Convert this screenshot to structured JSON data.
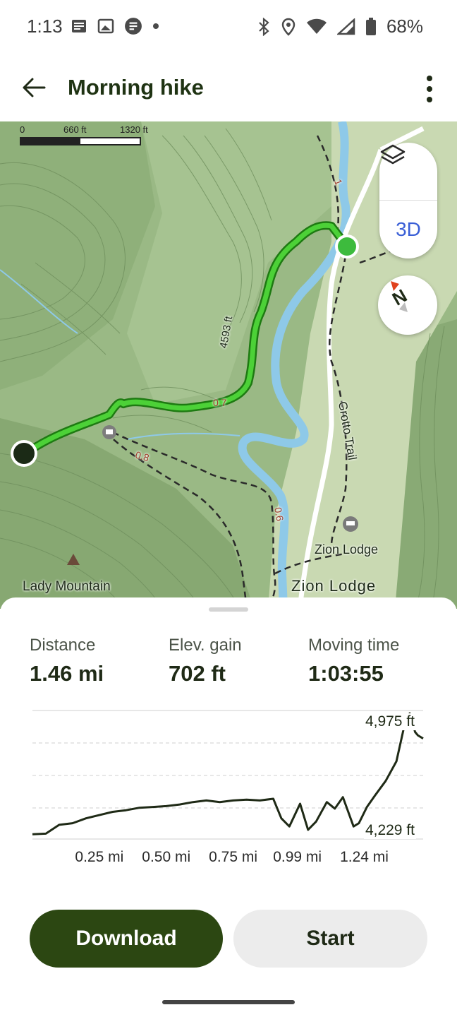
{
  "status_bar": {
    "time": "1:13",
    "battery": "68%",
    "icons": [
      "news-icon",
      "image-icon",
      "app-icon",
      "dot-icon",
      "bluetooth-icon",
      "location-icon",
      "wifi-icon",
      "signal-icon",
      "battery-icon"
    ]
  },
  "header": {
    "title": "Morning hike",
    "back_icon": "arrow-left-icon",
    "more_icon": "more-vertical-icon"
  },
  "map": {
    "scale": {
      "zero": "0",
      "mid": "660 ft",
      "max": "1320 ft"
    },
    "layers_icon": "layers-icon",
    "toggle_3d": "3D",
    "compass_letter": "N",
    "labels": {
      "peak_elevation": "4593 ft",
      "trail_name": "Grotto Trail",
      "lodge_poi": "Zion Lodge",
      "lodge_area": "Zion Lodge",
      "mountain": "Lady Mountain"
    },
    "mile_markers": [
      "1",
      "0.7",
      "0.8",
      "0.6"
    ],
    "colors": {
      "route": "#4cd137",
      "route_outline": "#1e7a12",
      "river": "#8ec9e8",
      "start": "#3dbb3d",
      "end": "#1b2a16"
    }
  },
  "stats": {
    "distance": {
      "label": "Distance",
      "value": "1.46 mi"
    },
    "elevation_gain": {
      "label": "Elev. gain",
      "value": "702 ft"
    },
    "moving_time": {
      "label": "Moving time",
      "value": "1:03:55"
    }
  },
  "chart_data": {
    "type": "line",
    "title": "",
    "xlabel": "",
    "ylabel": "",
    "x_tick_labels": [
      "0.25 mi",
      "0.50 mi",
      "0.75 mi",
      "0.99 mi",
      "1.24 mi"
    ],
    "x_ticks": [
      0.25,
      0.5,
      0.75,
      0.99,
      1.24
    ],
    "y_labels": {
      "max": "4,975 ft",
      "min": "4,229 ft"
    },
    "xlim": [
      0,
      1.46
    ],
    "ylim": [
      4229,
      4975
    ],
    "series": [
      {
        "x": [
          0.0,
          0.05,
          0.1,
          0.15,
          0.2,
          0.25,
          0.3,
          0.35,
          0.4,
          0.45,
          0.5,
          0.55,
          0.6,
          0.65,
          0.7,
          0.75,
          0.8,
          0.85,
          0.9,
          0.93,
          0.96,
          1.0,
          1.03,
          1.06,
          1.1,
          1.13,
          1.16,
          1.2,
          1.22,
          1.25,
          1.28,
          1.32,
          1.36,
          1.39,
          1.41,
          1.43,
          1.44,
          1.46
        ],
        "y": [
          4232,
          4236,
          4290,
          4300,
          4330,
          4350,
          4370,
          4380,
          4395,
          4400,
          4405,
          4415,
          4430,
          4440,
          4430,
          4440,
          4445,
          4440,
          4450,
          4330,
          4280,
          4420,
          4260,
          4310,
          4430,
          4390,
          4460,
          4280,
          4300,
          4400,
          4470,
          4560,
          4680,
          4900,
          4975,
          4860,
          4840,
          4820
        ]
      }
    ],
    "grid": true
  },
  "actions": {
    "download": "Download",
    "start": "Start"
  }
}
